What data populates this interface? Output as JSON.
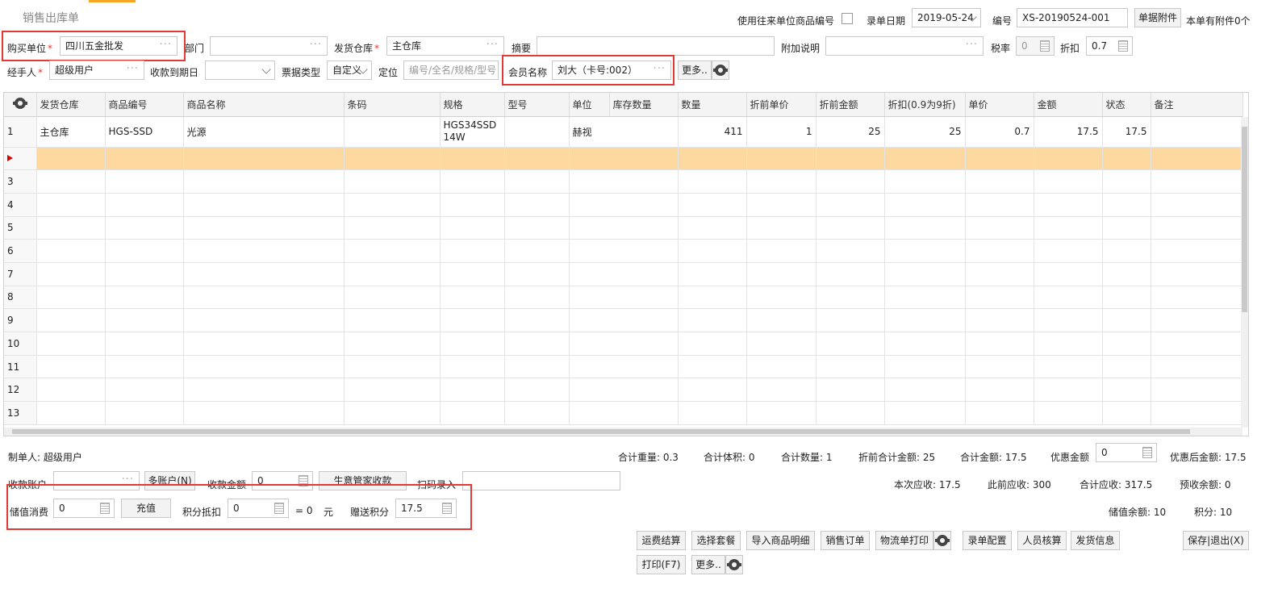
{
  "page": {
    "title": "销售出库单"
  },
  "header_right": {
    "use_partner_code_label": "使用往来单位商品编号",
    "entry_date_label": "录单日期",
    "entry_date_value": "2019-05-24",
    "number_label": "编号",
    "number_value": "XS-20190524-001",
    "attachment_button": "单据附件",
    "attachment_count": "本单有附件0个"
  },
  "row1": {
    "buyer_label": "购买单位",
    "buyer_value": "四川五金批发",
    "department_label": "部门",
    "department_value": "",
    "warehouse_label": "发货仓库",
    "warehouse_value": "主仓库",
    "summary_label": "摘要",
    "summary_value": "",
    "extra_note_label": "附加说明",
    "extra_note_value": "",
    "tax_label": "税率",
    "tax_value": "0",
    "discount_label": "折扣",
    "discount_value": "0.7"
  },
  "row2": {
    "handler_label": "经手人",
    "handler_value": "超级用户",
    "due_label": "收款到期日",
    "due_value": "",
    "invoice_label": "票据类型",
    "invoice_value": "自定义",
    "locate_label": "定位",
    "locate_placeholder": "编号/全名/规格/型号",
    "member_label": "会员名称",
    "member_value": "刘大（卡号:002）",
    "more_button": "更多.."
  },
  "grid": {
    "columns": [
      "发货仓库",
      "商品编号",
      "商品名称",
      "条码",
      "规格",
      "型号",
      "单位",
      "库存数量",
      "数量",
      "折前单价",
      "折前金额",
      "折扣(0.9为9折)",
      "单价",
      "金额",
      "状态",
      "备注"
    ],
    "rows": [
      {
        "no": "1",
        "cells": [
          "主仓库",
          "HGS-SSD",
          "光源",
          "",
          "HGS34SSD14W",
          "",
          "赫视",
          "411",
          "1",
          "25",
          "25",
          "0.7",
          "17.5",
          "17.5",
          "",
          ""
        ]
      }
    ],
    "empty_row_numbers": [
      "3",
      "4",
      "5",
      "6",
      "7",
      "8",
      "9",
      "10",
      "11",
      "12",
      "13"
    ]
  },
  "footer": {
    "maker": "制单人: 超级用户",
    "total_weight": "合计重量: 0.3",
    "total_volume": "合计体积: 0",
    "total_qty": "合计数量: 1",
    "pre_discount_total": "折前合计金额: 25",
    "total_amount": "合计金额: 17.5",
    "discount_amount_label": "优惠金额",
    "discount_amount_value": "0",
    "after_discount": "优惠后金额: 17.5",
    "account_label": "收款账户",
    "multi_account_button": "多账户(N)",
    "receive_amount_label": "收款金额",
    "receive_amount_value": "0",
    "steward_button": "生意管家收款",
    "scan_label": "扫码录入",
    "current_receivable": "本次应收: 17.5",
    "previous_receivable": "此前应收: 300",
    "total_receivable": "合计应收: 317.5",
    "prepaid_balance": "预收余额: 0",
    "stored_consume_label": "储值消费",
    "stored_consume_value": "0",
    "recharge_button": "充值",
    "points_deduct_label": "积分抵扣",
    "points_deduct_value": "0",
    "equals_text": "= 0",
    "yuan_text": "元",
    "gift_points_label": "赠送积分",
    "gift_points_value": "17.5",
    "stored_balance": "储值余额: 10",
    "points": "积分: 10"
  },
  "actions": {
    "freight": "运费结算",
    "package": "选择套餐",
    "import_detail": "导入商品明细",
    "sales_order": "销售订单",
    "logistics_print": "物流单打印",
    "entry_config": "录单配置",
    "staff_calc": "人员核算",
    "ship_info": "发货信息",
    "save_exit": "保存|退出(X)",
    "print": "打印(F7)",
    "more": "更多.."
  }
}
